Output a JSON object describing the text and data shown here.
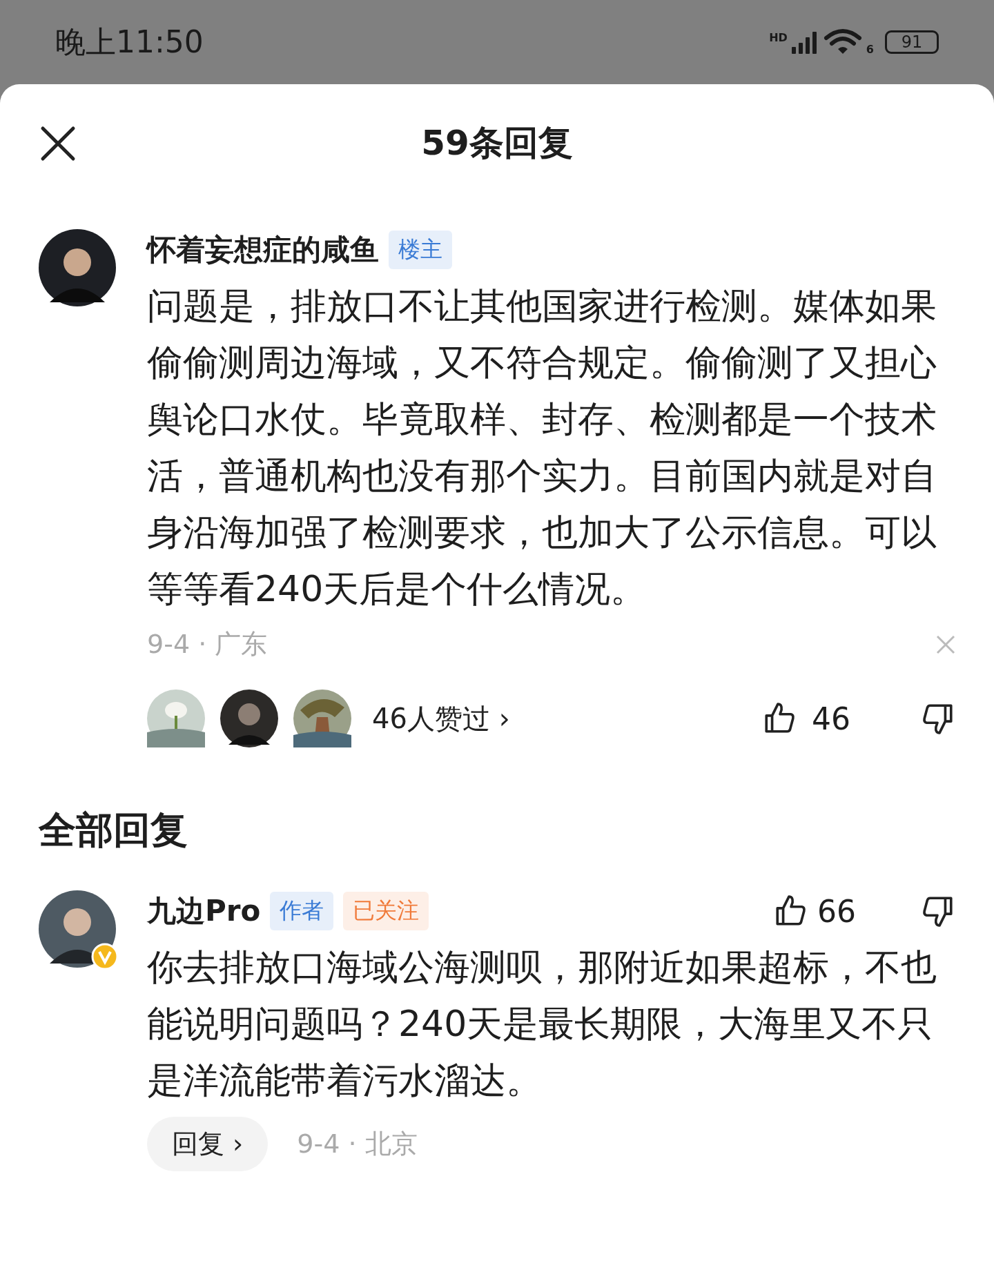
{
  "status_bar": {
    "time": "晚上11:50",
    "network": "HD",
    "wifi_band": "6",
    "battery": "91"
  },
  "sheet": {
    "title": "59条回复"
  },
  "post": {
    "author": "怀着妄想症的咸鱼",
    "badges": [
      {
        "label": "楼主",
        "color": "#3a7bd5"
      }
    ],
    "text": "问题是，排放口不让其他国家进行检测。媒体如果偷偷测周边海域，又不符合规定。偷偷测了又担心舆论口水仗。毕竟取样、封存、检测都是一个技术活，普通机构也没有那个实力。目前国内就是对自身沿海加强了检测要求，也加大了公示信息。可以等等看240天后是个什么情况。",
    "meta": "9-4 · 广东",
    "likers": "46人赞过",
    "likers_chevron": "›",
    "likes": "46"
  },
  "section_title": "全部回复",
  "replies": [
    {
      "author": "九边Pro",
      "verified": true,
      "badges": [
        {
          "label": "作者",
          "color": "#3a7bd5"
        },
        {
          "label": "已关注",
          "color": "#f07a3a"
        }
      ],
      "likes": "66",
      "text": "你去排放口海域公海测呗，那附近如果超标，不也能说明问题吗？240天是最长期限，大海里又不只是洋流能带着污水溜达。",
      "reply_button": "回复",
      "reply_chevron": "›",
      "meta": "9-4 · 北京"
    }
  ]
}
